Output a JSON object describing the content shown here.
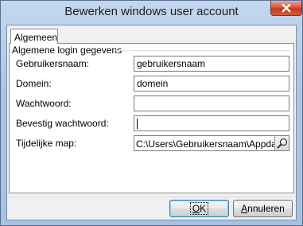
{
  "window": {
    "title": "Bewerken windows user account"
  },
  "tabs": [
    {
      "label": "Algemeen"
    }
  ],
  "group": {
    "title": "Algemene login gegevens"
  },
  "fields": {
    "gebruikersnaam": {
      "label": "Gebruikersnaam:",
      "value": "gebruikersnaam"
    },
    "domein": {
      "label": "Domein:",
      "value": "domein"
    },
    "wachtwoord": {
      "label": "Wachtwoord:",
      "value": ""
    },
    "bevestig": {
      "label": "Bevestig wachtwoord:",
      "value": ""
    },
    "map": {
      "label": "Tijdelijke map:",
      "value": "C:\\Users\\Gebruikersnaam\\Appdata\\Lo"
    }
  },
  "buttons": {
    "ok": {
      "mnemonic": "O",
      "rest": "K"
    },
    "cancel": {
      "mnemonic": "A",
      "rest": "nnuleren"
    }
  },
  "icons": {
    "close": "close-icon",
    "browse": "magnifier-icon"
  },
  "colors": {
    "titlebar": "#aac5e6",
    "close": "#c33a1f",
    "default_button_border": "#3c7fb1"
  }
}
